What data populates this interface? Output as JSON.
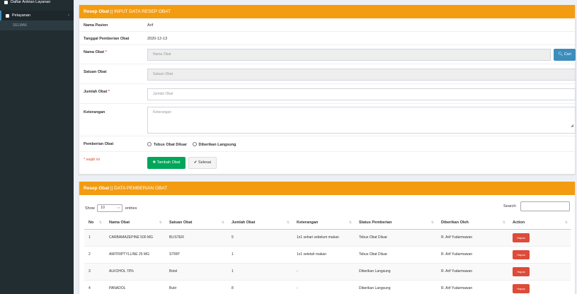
{
  "sidebar": {
    "top_item": "Daftar Antrian Layanan",
    "active_item": "Pelayanan",
    "chevron": "‹",
    "sub_item": "SELMAK"
  },
  "form_panel": {
    "title_bold": "Resep Obat",
    "title_rest": " || INPUT DATA RESEP OBAT",
    "fields": {
      "nama_pasien_label": "Nama Pasien",
      "nama_pasien_value": "Arif",
      "tanggal_label": "Tanggal Pemberian Obat",
      "tanggal_value": "2020-12-13",
      "nama_obat_label": "Nama Obat",
      "nama_obat_placeholder": "Nama Obat",
      "satuan_label": "Satuan Obat",
      "satuan_placeholder": "Satuan Obat",
      "jumlah_label": "Jumlah Obat",
      "jumlah_placeholder": "Jumlah Obat",
      "keterangan_label": "Keterangan",
      "keterangan_placeholder": "Keterangan",
      "pemberian_label": "Pemberian Obat",
      "opt_tebus": "Tebus Obat Diluar",
      "opt_langsung": "Diberikan Langsung",
      "required_mark": "*",
      "note": "* wajib isi"
    },
    "buttons": {
      "cari": "Cari",
      "tambah": "Tambah Obat",
      "selesai": "Selesai"
    }
  },
  "table_panel": {
    "title_bold": "Resep Obat",
    "title_rest": " || DATA PEMBERIAN OBAT",
    "show_label": "Show",
    "entries_value": "10",
    "entries_label": "entries",
    "search_label": "Search:",
    "columns": [
      "No",
      "Nama Obat",
      "Satuan Obat",
      "Jumlah Obat",
      "Keterangan",
      "Status Pemberian",
      "Diberikan Oleh",
      "Action"
    ],
    "rows": [
      {
        "no": "1",
        "nama": "CARBAMAZEPINE 500 MG",
        "satuan": "BLISTER",
        "jumlah": "5",
        "keterangan": "1x1 sehari sebelum makan",
        "status": "Tebus Obat Diluar",
        "oleh": "R. Arif Yudarmawan",
        "action": "Hapus"
      },
      {
        "no": "2",
        "nama": "AMITRIPTYLLINE 25 MG",
        "satuan": "STRIP",
        "jumlah": "1",
        "keterangan": "1x1 setelah makan",
        "status": "Tebus Obat Diluar",
        "oleh": "R. Arif Yudarmawan",
        "action": "Hapus"
      },
      {
        "no": "3",
        "nama": "ALKOHOL 70%",
        "satuan": "Botol",
        "jumlah": "1",
        "keterangan": "-",
        "status": "Diberikan Langsung",
        "oleh": "R. Arif Yudarmawan",
        "action": "Hapus"
      },
      {
        "no": "4",
        "nama": "PANADOL",
        "satuan": "Butir",
        "jumlah": "8",
        "keterangan": "-",
        "status": "Diberikan Langsung",
        "oleh": "R. Arif Yudarmawan",
        "action": "Hapus"
      }
    ]
  },
  "colors": {
    "panel_header": "#f39c12",
    "primary": "#3c8dbc",
    "success": "#00a65a",
    "danger": "#dd4b39",
    "sidebar": "#222d32"
  }
}
